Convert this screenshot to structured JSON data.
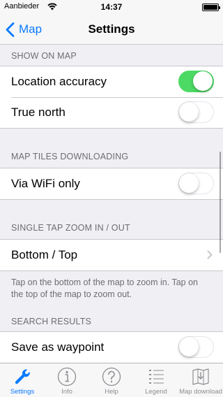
{
  "status_bar": {
    "carrier": "Aanbieder",
    "time": "14:37"
  },
  "nav": {
    "back_label": "Map",
    "title": "Settings"
  },
  "sections": {
    "show_on_map": {
      "header": "SHOW ON MAP",
      "rows": [
        {
          "label": "Location accuracy",
          "toggle": true
        },
        {
          "label": "True north",
          "toggle": false
        }
      ]
    },
    "tiles": {
      "header": "MAP TILES DOWNLOADING",
      "rows": [
        {
          "label": "Via WiFi only",
          "toggle": false
        }
      ]
    },
    "zoom": {
      "header": "SINGLE TAP ZOOM IN / OUT",
      "rows": [
        {
          "label": "Bottom / Top"
        }
      ],
      "footer": "Tap on the bottom of the map to zoom in. Tap on the top of the map to zoom out."
    },
    "search": {
      "header": "SEARCH RESULTS",
      "rows": [
        {
          "label": "Save as waypoint",
          "toggle": false
        }
      ]
    }
  },
  "tab_bar": {
    "tabs": [
      {
        "label": "Settings",
        "icon": "wrench-icon",
        "active": true
      },
      {
        "label": "Info",
        "icon": "info-icon",
        "active": false
      },
      {
        "label": "Help",
        "icon": "help-icon",
        "active": false
      },
      {
        "label": "Legend",
        "icon": "list-icon",
        "active": false
      },
      {
        "label": "Map download",
        "icon": "map-download-icon",
        "active": false
      }
    ]
  },
  "colors": {
    "accent": "#0a7aff",
    "toggle_on": "#4cd964",
    "background": "#efeff4"
  }
}
